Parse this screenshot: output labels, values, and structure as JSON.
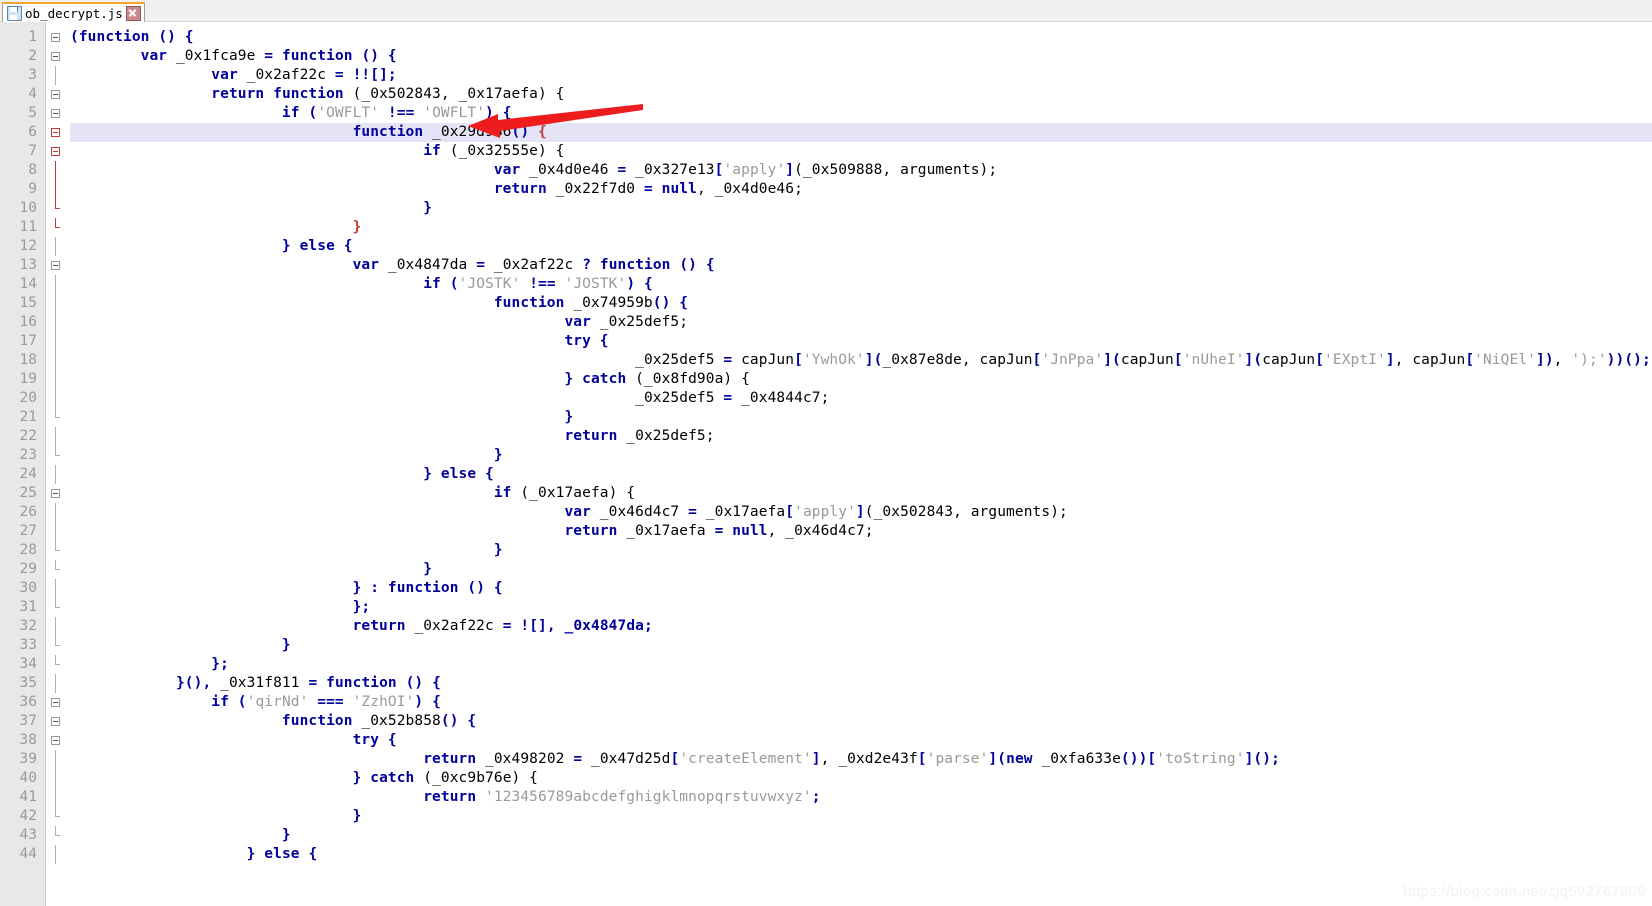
{
  "window": {
    "title": "ob_decrypt.js"
  },
  "tab": {
    "label": "ob_decrypt.js",
    "save_icon": "save-disk-icon",
    "close_icon": "close-icon"
  },
  "watermark": {
    "text": "https://blog.csdn.net/zjq592767809"
  },
  "annotation": {
    "type": "arrow",
    "color": "#ee1c1c",
    "points_to_line": 5
  },
  "editor": {
    "language": "JavaScript",
    "highlighted_line": 6,
    "first_visible_line": 1,
    "last_visible_line": 44,
    "colors": {
      "keyword": "#00009a",
      "string": "#9a9a9a",
      "text": "#000000",
      "unmatched_brace": "#c23b3b",
      "gutter_bg": "#e8e8e8",
      "gutter_fg": "#9a9a9a",
      "highlight_bg": "#e4e4f6"
    },
    "lines": [
      {
        "n": 1,
        "fold": "open",
        "indent": 0,
        "tokens": [
          {
            "t": "(",
            "c": "pun"
          },
          {
            "t": "function",
            "c": "kw"
          },
          {
            "t": " () {",
            "c": "pun"
          }
        ]
      },
      {
        "n": 2,
        "fold": "open",
        "indent": 2,
        "tokens": [
          {
            "t": "var",
            "c": "kw"
          },
          {
            "t": " _0x1fca9e ",
            "c": "id"
          },
          {
            "t": "=",
            "c": "op"
          },
          {
            "t": " ",
            "c": "id"
          },
          {
            "t": "function",
            "c": "kw"
          },
          {
            "t": " () {",
            "c": "pun"
          }
        ]
      },
      {
        "n": 3,
        "fold": "line",
        "indent": 4,
        "tokens": [
          {
            "t": "var",
            "c": "kw"
          },
          {
            "t": " _0x2af22c ",
            "c": "id"
          },
          {
            "t": "=",
            "c": "op"
          },
          {
            "t": " !![];",
            "c": "pun"
          }
        ]
      },
      {
        "n": 4,
        "fold": "open",
        "indent": 4,
        "tokens": [
          {
            "t": "return",
            "c": "kw"
          },
          {
            "t": " ",
            "c": "id"
          },
          {
            "t": "function",
            "c": "kw"
          },
          {
            "t": " (_0x502843, _0x17aefa) {",
            "c": "id"
          }
        ]
      },
      {
        "n": 5,
        "fold": "open",
        "indent": 6,
        "tokens": [
          {
            "t": "if",
            "c": "kw"
          },
          {
            "t": " (",
            "c": "pun"
          },
          {
            "t": "'OWFLT'",
            "c": "str"
          },
          {
            "t": " !== ",
            "c": "op"
          },
          {
            "t": "'OWFLT'",
            "c": "str"
          },
          {
            "t": ") {",
            "c": "pun"
          }
        ]
      },
      {
        "n": 6,
        "fold": "openred",
        "indent": 8,
        "highlight": true,
        "tokens": [
          {
            "t": "function",
            "c": "kw"
          },
          {
            "t": " _0x29d986",
            "c": "id"
          },
          {
            "t": "() ",
            "c": "pun"
          },
          {
            "t": "{",
            "c": "red"
          }
        ]
      },
      {
        "n": 7,
        "fold": "openred",
        "indent": 10,
        "tokens": [
          {
            "t": "if",
            "c": "kw"
          },
          {
            "t": " (_0x32555e) {",
            "c": "id"
          }
        ]
      },
      {
        "n": 8,
        "fold": "linered",
        "indent": 12,
        "tokens": [
          {
            "t": "var",
            "c": "kw"
          },
          {
            "t": " _0x4d0e46 ",
            "c": "id"
          },
          {
            "t": "=",
            "c": "op"
          },
          {
            "t": " _0x327e13",
            "c": "id"
          },
          {
            "t": "[",
            "c": "pun"
          },
          {
            "t": "'apply'",
            "c": "str"
          },
          {
            "t": "]",
            "c": "pun"
          },
          {
            "t": "(_0x509888, arguments);",
            "c": "id"
          }
        ]
      },
      {
        "n": 9,
        "fold": "linered",
        "indent": 12,
        "tokens": [
          {
            "t": "return",
            "c": "kw"
          },
          {
            "t": " _0x22f7d0 ",
            "c": "id"
          },
          {
            "t": "=",
            "c": "op"
          },
          {
            "t": " ",
            "c": "id"
          },
          {
            "t": "null",
            "c": "kw"
          },
          {
            "t": ", _0x4d0e46;",
            "c": "id"
          }
        ]
      },
      {
        "n": 10,
        "fold": "endred",
        "indent": 10,
        "tokens": [
          {
            "t": "}",
            "c": "pun"
          }
        ]
      },
      {
        "n": 11,
        "fold": "endred",
        "indent": 8,
        "tokens": [
          {
            "t": "}",
            "c": "red"
          }
        ]
      },
      {
        "n": 12,
        "fold": "line",
        "indent": 6,
        "tokens": [
          {
            "t": "} ",
            "c": "pun"
          },
          {
            "t": "else",
            "c": "kw"
          },
          {
            "t": " {",
            "c": "pun"
          }
        ]
      },
      {
        "n": 13,
        "fold": "open",
        "indent": 8,
        "tokens": [
          {
            "t": "var",
            "c": "kw"
          },
          {
            "t": " _0x4847da ",
            "c": "id"
          },
          {
            "t": "=",
            "c": "op"
          },
          {
            "t": " _0x2af22c ",
            "c": "id"
          },
          {
            "t": "?",
            "c": "op"
          },
          {
            "t": " ",
            "c": "id"
          },
          {
            "t": "function",
            "c": "kw"
          },
          {
            "t": " () {",
            "c": "pun"
          }
        ]
      },
      {
        "n": 14,
        "fold": "line",
        "indent": 10,
        "tokens": [
          {
            "t": "if",
            "c": "kw"
          },
          {
            "t": " (",
            "c": "pun"
          },
          {
            "t": "'JOSTK'",
            "c": "str"
          },
          {
            "t": " !== ",
            "c": "op"
          },
          {
            "t": "'JOSTK'",
            "c": "str"
          },
          {
            "t": ") {",
            "c": "pun"
          }
        ]
      },
      {
        "n": 15,
        "fold": "line",
        "indent": 12,
        "tokens": [
          {
            "t": "function",
            "c": "kw"
          },
          {
            "t": " _0x74959b",
            "c": "id"
          },
          {
            "t": "() {",
            "c": "pun"
          }
        ]
      },
      {
        "n": 16,
        "fold": "line",
        "indent": 14,
        "tokens": [
          {
            "t": "var",
            "c": "kw"
          },
          {
            "t": " _0x25def5;",
            "c": "id"
          }
        ]
      },
      {
        "n": 17,
        "fold": "line",
        "indent": 14,
        "tokens": [
          {
            "t": "try",
            "c": "kw"
          },
          {
            "t": " {",
            "c": "pun"
          }
        ]
      },
      {
        "n": 18,
        "fold": "line",
        "indent": 16,
        "tokens": [
          {
            "t": "_0x25def5 ",
            "c": "id"
          },
          {
            "t": "=",
            "c": "op"
          },
          {
            "t": " capJun",
            "c": "id"
          },
          {
            "t": "[",
            "c": "pun"
          },
          {
            "t": "'YwhOk'",
            "c": "str"
          },
          {
            "t": "]",
            "c": "pun"
          },
          {
            "t": "(",
            "c": "pun"
          },
          {
            "t": "_0x87e8de, capJun",
            "c": "id"
          },
          {
            "t": "[",
            "c": "pun"
          },
          {
            "t": "'JnPpa'",
            "c": "str"
          },
          {
            "t": "]",
            "c": "pun"
          },
          {
            "t": "(",
            "c": "pun"
          },
          {
            "t": "capJun",
            "c": "id"
          },
          {
            "t": "[",
            "c": "pun"
          },
          {
            "t": "'nUheI'",
            "c": "str"
          },
          {
            "t": "]",
            "c": "pun"
          },
          {
            "t": "(",
            "c": "pun"
          },
          {
            "t": "capJun",
            "c": "id"
          },
          {
            "t": "[",
            "c": "pun"
          },
          {
            "t": "'EXptI'",
            "c": "str"
          },
          {
            "t": "]",
            "c": "pun"
          },
          {
            "t": ", capJun",
            "c": "id"
          },
          {
            "t": "[",
            "c": "pun"
          },
          {
            "t": "'NiQEl'",
            "c": "str"
          },
          {
            "t": "])",
            "c": "pun"
          },
          {
            "t": ", ",
            "c": "id"
          },
          {
            "t": "');'",
            "c": "str"
          },
          {
            "t": "))();",
            "c": "pun"
          }
        ]
      },
      {
        "n": 19,
        "fold": "line",
        "indent": 14,
        "tokens": [
          {
            "t": "} ",
            "c": "pun"
          },
          {
            "t": "catch",
            "c": "kw"
          },
          {
            "t": " (_0x8fd90a) {",
            "c": "id"
          }
        ]
      },
      {
        "n": 20,
        "fold": "line",
        "indent": 16,
        "tokens": [
          {
            "t": "_0x25def5 ",
            "c": "id"
          },
          {
            "t": "=",
            "c": "op"
          },
          {
            "t": " _0x4844c7;",
            "c": "id"
          }
        ]
      },
      {
        "n": 21,
        "fold": "end",
        "indent": 14,
        "tokens": [
          {
            "t": "}",
            "c": "pun"
          }
        ]
      },
      {
        "n": 22,
        "fold": "line",
        "indent": 14,
        "tokens": [
          {
            "t": "return",
            "c": "kw"
          },
          {
            "t": " _0x25def5;",
            "c": "id"
          }
        ]
      },
      {
        "n": 23,
        "fold": "end",
        "indent": 12,
        "tokens": [
          {
            "t": "}",
            "c": "pun"
          }
        ]
      },
      {
        "n": 24,
        "fold": "line",
        "indent": 10,
        "tokens": [
          {
            "t": "} ",
            "c": "pun"
          },
          {
            "t": "else",
            "c": "kw"
          },
          {
            "t": " {",
            "c": "pun"
          }
        ]
      },
      {
        "n": 25,
        "fold": "open",
        "indent": 12,
        "tokens": [
          {
            "t": "if",
            "c": "kw"
          },
          {
            "t": " (_0x17aefa) {",
            "c": "id"
          }
        ]
      },
      {
        "n": 26,
        "fold": "line",
        "indent": 14,
        "tokens": [
          {
            "t": "var",
            "c": "kw"
          },
          {
            "t": " _0x46d4c7 ",
            "c": "id"
          },
          {
            "t": "=",
            "c": "op"
          },
          {
            "t": " _0x17aefa",
            "c": "id"
          },
          {
            "t": "[",
            "c": "pun"
          },
          {
            "t": "'apply'",
            "c": "str"
          },
          {
            "t": "]",
            "c": "pun"
          },
          {
            "t": "(_0x502843, arguments);",
            "c": "id"
          }
        ]
      },
      {
        "n": 27,
        "fold": "line",
        "indent": 14,
        "tokens": [
          {
            "t": "return",
            "c": "kw"
          },
          {
            "t": " _0x17aefa ",
            "c": "id"
          },
          {
            "t": "=",
            "c": "op"
          },
          {
            "t": " ",
            "c": "id"
          },
          {
            "t": "null",
            "c": "kw"
          },
          {
            "t": ", _0x46d4c7;",
            "c": "id"
          }
        ]
      },
      {
        "n": 28,
        "fold": "end",
        "indent": 12,
        "tokens": [
          {
            "t": "}",
            "c": "pun"
          }
        ]
      },
      {
        "n": 29,
        "fold": "end",
        "indent": 10,
        "tokens": [
          {
            "t": "}",
            "c": "pun"
          }
        ]
      },
      {
        "n": 30,
        "fold": "line",
        "indent": 8,
        "tokens": [
          {
            "t": "} : ",
            "c": "pun"
          },
          {
            "t": "function",
            "c": "kw"
          },
          {
            "t": " () {",
            "c": "pun"
          }
        ]
      },
      {
        "n": 31,
        "fold": "end",
        "indent": 8,
        "tokens": [
          {
            "t": "};",
            "c": "pun"
          }
        ]
      },
      {
        "n": 32,
        "fold": "line",
        "indent": 8,
        "tokens": [
          {
            "t": "return",
            "c": "kw"
          },
          {
            "t": " _0x2af22c ",
            "c": "id"
          },
          {
            "t": "=",
            "c": "op"
          },
          {
            "t": " ![], _0x4847da;",
            "c": "pun"
          }
        ]
      },
      {
        "n": 33,
        "fold": "end",
        "indent": 6,
        "tokens": [
          {
            "t": "}",
            "c": "pun"
          }
        ]
      },
      {
        "n": 34,
        "fold": "end",
        "indent": 4,
        "tokens": [
          {
            "t": "};",
            "c": "pun"
          }
        ]
      },
      {
        "n": 35,
        "fold": "line",
        "indent": 3,
        "tokens": [
          {
            "t": "}(), ",
            "c": "pun"
          },
          {
            "t": "_0x31f811 ",
            "c": "id"
          },
          {
            "t": "=",
            "c": "op"
          },
          {
            "t": " ",
            "c": "id"
          },
          {
            "t": "function",
            "c": "kw"
          },
          {
            "t": " () {",
            "c": "pun"
          }
        ]
      },
      {
        "n": 36,
        "fold": "open",
        "indent": 4,
        "tokens": [
          {
            "t": "if",
            "c": "kw"
          },
          {
            "t": " (",
            "c": "pun"
          },
          {
            "t": "'qirNd'",
            "c": "str"
          },
          {
            "t": " === ",
            "c": "op"
          },
          {
            "t": "'ZzhOI'",
            "c": "str"
          },
          {
            "t": ") {",
            "c": "pun"
          }
        ]
      },
      {
        "n": 37,
        "fold": "open",
        "indent": 6,
        "tokens": [
          {
            "t": "function",
            "c": "kw"
          },
          {
            "t": " _0x52b858",
            "c": "id"
          },
          {
            "t": "() {",
            "c": "pun"
          }
        ]
      },
      {
        "n": 38,
        "fold": "open",
        "indent": 8,
        "tokens": [
          {
            "t": "try",
            "c": "kw"
          },
          {
            "t": " {",
            "c": "pun"
          }
        ]
      },
      {
        "n": 39,
        "fold": "line",
        "indent": 10,
        "tokens": [
          {
            "t": "return",
            "c": "kw"
          },
          {
            "t": " _0x498202 ",
            "c": "id"
          },
          {
            "t": "=",
            "c": "op"
          },
          {
            "t": " _0x47d25d",
            "c": "id"
          },
          {
            "t": "[",
            "c": "pun"
          },
          {
            "t": "'createElement'",
            "c": "str"
          },
          {
            "t": "]",
            "c": "pun"
          },
          {
            "t": ", _0xd2e43f",
            "c": "id"
          },
          {
            "t": "[",
            "c": "pun"
          },
          {
            "t": "'parse'",
            "c": "str"
          },
          {
            "t": "]",
            "c": "pun"
          },
          {
            "t": "(",
            "c": "pun"
          },
          {
            "t": "new",
            "c": "kw"
          },
          {
            "t": " _0xfa633e",
            "c": "id"
          },
          {
            "t": "())",
            "c": "pun"
          },
          {
            "t": "[",
            "c": "pun"
          },
          {
            "t": "'toString'",
            "c": "str"
          },
          {
            "t": "]",
            "c": "pun"
          },
          {
            "t": "();",
            "c": "pun"
          }
        ]
      },
      {
        "n": 40,
        "fold": "line",
        "indent": 8,
        "tokens": [
          {
            "t": "} ",
            "c": "pun"
          },
          {
            "t": "catch",
            "c": "kw"
          },
          {
            "t": " (_0xc9b76e) {",
            "c": "id"
          }
        ]
      },
      {
        "n": 41,
        "fold": "line",
        "indent": 10,
        "tokens": [
          {
            "t": "return",
            "c": "kw"
          },
          {
            "t": " ",
            "c": "id"
          },
          {
            "t": "'123456789abcdefghigklmnopqrstuvwxyz'",
            "c": "str"
          },
          {
            "t": ";",
            "c": "pun"
          }
        ]
      },
      {
        "n": 42,
        "fold": "end",
        "indent": 8,
        "tokens": [
          {
            "t": "}",
            "c": "pun"
          }
        ]
      },
      {
        "n": 43,
        "fold": "end",
        "indent": 6,
        "tokens": [
          {
            "t": "}",
            "c": "pun"
          }
        ]
      },
      {
        "n": 44,
        "fold": "line",
        "indent": 5,
        "tokens": [
          {
            "t": "} ",
            "c": "pun"
          },
          {
            "t": "else",
            "c": "kw"
          },
          {
            "t": " {",
            "c": "pun"
          }
        ]
      }
    ]
  }
}
